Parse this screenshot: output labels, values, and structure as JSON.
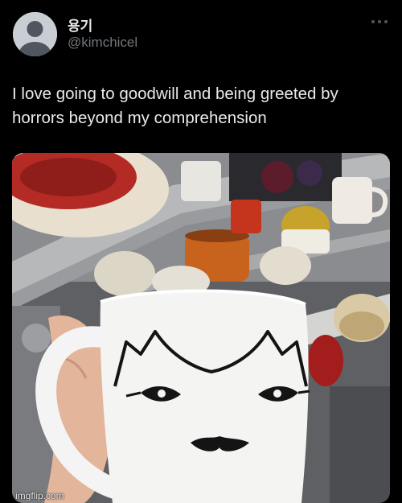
{
  "tweet": {
    "display_name": "용기",
    "handle": "@kimchicel",
    "text": "I love going to goodwill and being greeted by horrors beyond my comprehension",
    "more_icon": "ellipsis-icon",
    "avatar_icon": "default-avatar-icon"
  },
  "photo": {
    "watermark": "imgflip.com"
  },
  "colors": {
    "background": "#000000",
    "text_primary": "#e7e9ea",
    "text_secondary": "#71767b"
  }
}
